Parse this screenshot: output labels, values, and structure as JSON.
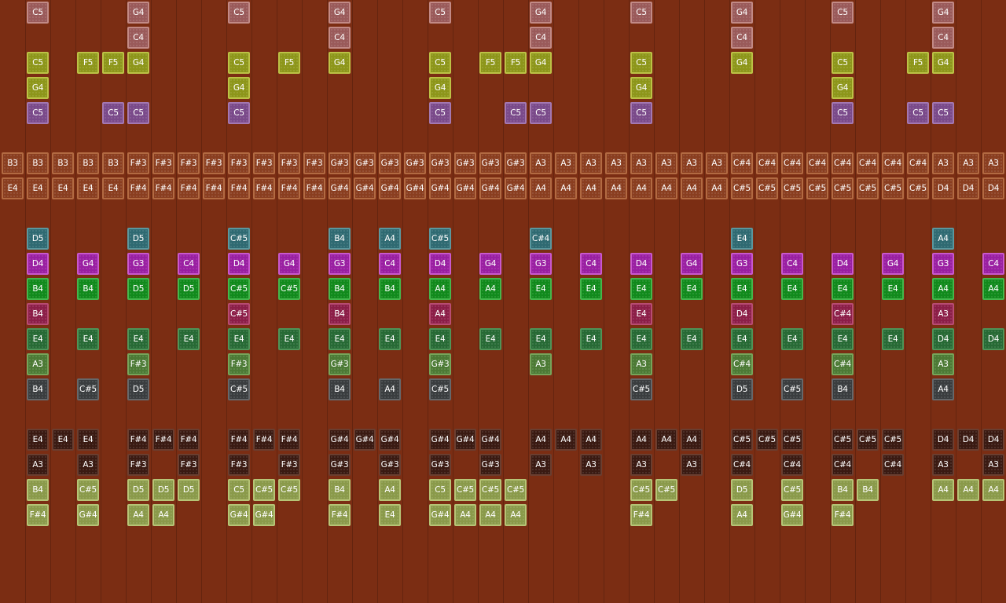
{
  "grid": {
    "columns": 40,
    "row_count": 21,
    "background": "#7b2d13"
  },
  "palette": {
    "pink": {
      "bg": "#9a5a5a",
      "border": "#c28a86",
      "text": "#ffffff"
    },
    "lime": {
      "bg": "#8d961a",
      "border": "#bcc246",
      "text": "#ffffff"
    },
    "violet": {
      "bg": "#7a4a8a",
      "border": "#a478b2",
      "text": "#ffffff"
    },
    "copper": {
      "bg": "#8a3e20",
      "border": "#b26a42",
      "text": "#ffffff"
    },
    "teal": {
      "bg": "#2f6a72",
      "border": "#5a979e",
      "text": "#ffffff"
    },
    "magenta": {
      "bg": "#9a1fa2",
      "border": "#c958ce",
      "text": "#ffffff"
    },
    "green": {
      "bg": "#118a1c",
      "border": "#45b64c",
      "text": "#ffffff"
    },
    "crimson": {
      "bg": "#8c1e48",
      "border": "#b84c72",
      "text": "#ffffff"
    },
    "forest": {
      "bg": "#276a35",
      "border": "#4f9458",
      "text": "#ffffff"
    },
    "olive": {
      "bg": "#4c7a35",
      "border": "#76a45a",
      "text": "#ffffff"
    },
    "slate": {
      "bg": "#3a3d3f",
      "border": "#65686b",
      "text": "#ffffff"
    },
    "dark": {
      "bg": "#3a1a12",
      "border": "#6a3e30",
      "text": "#ffffff"
    },
    "sage": {
      "bg": "#8a9a4a",
      "border": "#b6c476",
      "text": "#ffffff"
    }
  },
  "rows": [
    {
      "row": 0,
      "color": "pink",
      "cells": [
        [
          1,
          "C5"
        ],
        [
          5,
          "G4"
        ],
        [
          9,
          "C5"
        ],
        [
          13,
          "G4"
        ],
        [
          17,
          "C5"
        ],
        [
          21,
          "G4"
        ],
        [
          25,
          "C5"
        ],
        [
          29,
          "G4"
        ],
        [
          33,
          "C5"
        ],
        [
          37,
          "G4"
        ]
      ]
    },
    {
      "row": 1,
      "color": "pink",
      "cells": [
        [
          5,
          "C4"
        ],
        [
          13,
          "C4"
        ],
        [
          21,
          "C4"
        ],
        [
          29,
          "C4"
        ],
        [
          37,
          "C4"
        ]
      ]
    },
    {
      "row": 2,
      "color": "lime",
      "cells": [
        [
          1,
          "C5"
        ],
        [
          3,
          "F5"
        ],
        [
          4,
          "F5"
        ],
        [
          5,
          "G4"
        ],
        [
          9,
          "C5"
        ],
        [
          11,
          "F5"
        ],
        [
          13,
          "G4"
        ],
        [
          17,
          "C5"
        ],
        [
          19,
          "F5"
        ],
        [
          20,
          "F5"
        ],
        [
          21,
          "G4"
        ],
        [
          25,
          "C5"
        ],
        [
          29,
          "G4"
        ],
        [
          33,
          "C5"
        ],
        [
          36,
          "F5"
        ],
        [
          37,
          "G4"
        ]
      ]
    },
    {
      "row": 3,
      "color": "lime",
      "cells": [
        [
          1,
          "G4"
        ],
        [
          9,
          "G4"
        ],
        [
          17,
          "G4"
        ],
        [
          25,
          "G4"
        ],
        [
          33,
          "G4"
        ]
      ]
    },
    {
      "row": 4,
      "color": "violet",
      "cells": [
        [
          1,
          "C5"
        ],
        [
          4,
          "C5"
        ],
        [
          5,
          "C5"
        ],
        [
          9,
          "C5"
        ],
        [
          17,
          "C5"
        ],
        [
          20,
          "C5"
        ],
        [
          21,
          "C5"
        ],
        [
          25,
          "C5"
        ],
        [
          33,
          "C5"
        ],
        [
          36,
          "C5"
        ],
        [
          37,
          "C5"
        ]
      ]
    },
    {
      "row": 5,
      "color": "copper",
      "cells": []
    },
    {
      "row": 6,
      "color": "copper",
      "cells": [
        [
          0,
          "B3"
        ],
        [
          1,
          "B3"
        ],
        [
          2,
          "B3"
        ],
        [
          3,
          "B3"
        ],
        [
          4,
          "B3"
        ],
        [
          5,
          "F#3"
        ],
        [
          6,
          "F#3"
        ],
        [
          7,
          "F#3"
        ],
        [
          8,
          "F#3"
        ],
        [
          9,
          "F#3"
        ],
        [
          10,
          "F#3"
        ],
        [
          11,
          "F#3"
        ],
        [
          12,
          "F#3"
        ],
        [
          13,
          "G#3"
        ],
        [
          14,
          "G#3"
        ],
        [
          15,
          "G#3"
        ],
        [
          16,
          "G#3"
        ],
        [
          17,
          "G#3"
        ],
        [
          18,
          "G#3"
        ],
        [
          19,
          "G#3"
        ],
        [
          20,
          "G#3"
        ],
        [
          21,
          "A3"
        ],
        [
          22,
          "A3"
        ],
        [
          23,
          "A3"
        ],
        [
          24,
          "A3"
        ],
        [
          25,
          "A3"
        ],
        [
          26,
          "A3"
        ],
        [
          27,
          "A3"
        ],
        [
          28,
          "A3"
        ],
        [
          29,
          "C#4"
        ],
        [
          30,
          "C#4"
        ],
        [
          31,
          "C#4"
        ],
        [
          32,
          "C#4"
        ],
        [
          33,
          "C#4"
        ],
        [
          34,
          "C#4"
        ],
        [
          35,
          "C#4"
        ],
        [
          36,
          "C#4"
        ],
        [
          37,
          "A3"
        ],
        [
          38,
          "A3"
        ],
        [
          39,
          "A3"
        ]
      ]
    },
    {
      "row": 7,
      "color": "copper",
      "cells": [
        [
          0,
          "E4"
        ],
        [
          1,
          "E4"
        ],
        [
          2,
          "E4"
        ],
        [
          3,
          "E4"
        ],
        [
          4,
          "E4"
        ],
        [
          5,
          "F#4"
        ],
        [
          6,
          "F#4"
        ],
        [
          7,
          "F#4"
        ],
        [
          8,
          "F#4"
        ],
        [
          9,
          "F#4"
        ],
        [
          10,
          "F#4"
        ],
        [
          11,
          "F#4"
        ],
        [
          12,
          "F#4"
        ],
        [
          13,
          "G#4"
        ],
        [
          14,
          "G#4"
        ],
        [
          15,
          "G#4"
        ],
        [
          16,
          "G#4"
        ],
        [
          17,
          "G#4"
        ],
        [
          18,
          "G#4"
        ],
        [
          19,
          "G#4"
        ],
        [
          20,
          "G#4"
        ],
        [
          21,
          "A4"
        ],
        [
          22,
          "A4"
        ],
        [
          23,
          "A4"
        ],
        [
          24,
          "A4"
        ],
        [
          25,
          "A4"
        ],
        [
          26,
          "A4"
        ],
        [
          27,
          "A4"
        ],
        [
          28,
          "A4"
        ],
        [
          29,
          "C#5"
        ],
        [
          30,
          "C#5"
        ],
        [
          31,
          "C#5"
        ],
        [
          32,
          "C#5"
        ],
        [
          33,
          "C#5"
        ],
        [
          34,
          "C#5"
        ],
        [
          35,
          "C#5"
        ],
        [
          36,
          "C#5"
        ],
        [
          37,
          "D4"
        ],
        [
          38,
          "D4"
        ],
        [
          39,
          "D4"
        ]
      ]
    },
    {
      "row": 8,
      "color": "copper",
      "cells": []
    },
    {
      "row": 9,
      "color": "teal",
      "cells": [
        [
          1,
          "D5"
        ],
        [
          5,
          "D5"
        ],
        [
          9,
          "C#5"
        ],
        [
          13,
          "B4"
        ],
        [
          15,
          "A4"
        ],
        [
          17,
          "C#5"
        ],
        [
          21,
          "C#4"
        ],
        [
          29,
          "E4"
        ],
        [
          37,
          "A4"
        ]
      ]
    },
    {
      "row": 10,
      "color": "magenta",
      "cells": [
        [
          1,
          "D4"
        ],
        [
          3,
          "G4"
        ],
        [
          5,
          "G3"
        ],
        [
          7,
          "C4"
        ],
        [
          9,
          "D4"
        ],
        [
          11,
          "G4"
        ],
        [
          13,
          "G3"
        ],
        [
          15,
          "C4"
        ],
        [
          17,
          "D4"
        ],
        [
          19,
          "G4"
        ],
        [
          21,
          "G3"
        ],
        [
          23,
          "C4"
        ],
        [
          25,
          "D4"
        ],
        [
          27,
          "G4"
        ],
        [
          29,
          "G3"
        ],
        [
          31,
          "C4"
        ],
        [
          33,
          "D4"
        ],
        [
          35,
          "G4"
        ],
        [
          37,
          "G3"
        ],
        [
          39,
          "C4"
        ]
      ]
    },
    {
      "row": 11,
      "color": "green",
      "cells": [
        [
          1,
          "B4"
        ],
        [
          3,
          "B4"
        ],
        [
          5,
          "D5"
        ],
        [
          7,
          "D5"
        ],
        [
          9,
          "C#5"
        ],
        [
          11,
          "C#5"
        ],
        [
          13,
          "B4"
        ],
        [
          15,
          "B4"
        ],
        [
          17,
          "A4"
        ],
        [
          19,
          "A4"
        ],
        [
          21,
          "E4"
        ],
        [
          23,
          "E4"
        ],
        [
          25,
          "E4"
        ],
        [
          27,
          "E4"
        ],
        [
          29,
          "E4"
        ],
        [
          31,
          "E4"
        ],
        [
          33,
          "E4"
        ],
        [
          35,
          "E4"
        ],
        [
          37,
          "A4"
        ],
        [
          39,
          "A4"
        ]
      ]
    },
    {
      "row": 12,
      "color": "crimson",
      "cells": [
        [
          1,
          "B4"
        ],
        [
          9,
          "C#5"
        ],
        [
          13,
          "B4"
        ],
        [
          17,
          "A4"
        ],
        [
          25,
          "E4"
        ],
        [
          29,
          "D4"
        ],
        [
          33,
          "C#4"
        ],
        [
          37,
          "A3"
        ]
      ]
    },
    {
      "row": 13,
      "color": "forest",
      "cells": [
        [
          1,
          "E4"
        ],
        [
          3,
          "E4"
        ],
        [
          5,
          "E4"
        ],
        [
          7,
          "E4"
        ],
        [
          9,
          "E4"
        ],
        [
          11,
          "E4"
        ],
        [
          13,
          "E4"
        ],
        [
          15,
          "E4"
        ],
        [
          17,
          "E4"
        ],
        [
          19,
          "E4"
        ],
        [
          21,
          "E4"
        ],
        [
          23,
          "E4"
        ],
        [
          25,
          "E4"
        ],
        [
          27,
          "E4"
        ],
        [
          29,
          "E4"
        ],
        [
          31,
          "E4"
        ],
        [
          33,
          "E4"
        ],
        [
          35,
          "E4"
        ],
        [
          37,
          "D4"
        ],
        [
          39,
          "D4"
        ]
      ]
    },
    {
      "row": 14,
      "color": "olive",
      "cells": [
        [
          1,
          "A3"
        ],
        [
          5,
          "F#3"
        ],
        [
          9,
          "F#3"
        ],
        [
          13,
          "G#3"
        ],
        [
          17,
          "G#3"
        ],
        [
          21,
          "A3"
        ],
        [
          25,
          "A3"
        ],
        [
          29,
          "C#4"
        ],
        [
          33,
          "C#4"
        ],
        [
          37,
          "A3"
        ]
      ]
    },
    {
      "row": 15,
      "color": "slate",
      "cells": [
        [
          1,
          "B4"
        ],
        [
          3,
          "C#5"
        ],
        [
          5,
          "D5"
        ],
        [
          9,
          "C#5"
        ],
        [
          13,
          "B4"
        ],
        [
          15,
          "A4"
        ],
        [
          17,
          "C#5"
        ],
        [
          25,
          "C#5"
        ],
        [
          29,
          "D5"
        ],
        [
          31,
          "C#5"
        ],
        [
          33,
          "B4"
        ],
        [
          37,
          "A4"
        ]
      ]
    },
    {
      "row": 16,
      "color": "dark",
      "cells": []
    },
    {
      "row": 17,
      "color": "dark",
      "cells": [
        [
          1,
          "E4"
        ],
        [
          2,
          "E4"
        ],
        [
          3,
          "E4"
        ],
        [
          5,
          "F#4"
        ],
        [
          6,
          "F#4"
        ],
        [
          7,
          "F#4"
        ],
        [
          9,
          "F#4"
        ],
        [
          10,
          "F#4"
        ],
        [
          11,
          "F#4"
        ],
        [
          13,
          "G#4"
        ],
        [
          14,
          "G#4"
        ],
        [
          15,
          "G#4"
        ],
        [
          17,
          "G#4"
        ],
        [
          18,
          "G#4"
        ],
        [
          19,
          "G#4"
        ],
        [
          21,
          "A4"
        ],
        [
          22,
          "A4"
        ],
        [
          23,
          "A4"
        ],
        [
          25,
          "A4"
        ],
        [
          26,
          "A4"
        ],
        [
          27,
          "A4"
        ],
        [
          29,
          "C#5"
        ],
        [
          30,
          "C#5"
        ],
        [
          31,
          "C#5"
        ],
        [
          33,
          "C#5"
        ],
        [
          34,
          "C#5"
        ],
        [
          35,
          "C#5"
        ],
        [
          37,
          "D4"
        ],
        [
          38,
          "D4"
        ],
        [
          39,
          "D4"
        ]
      ]
    },
    {
      "row": 18,
      "color": "dark",
      "cells": [
        [
          1,
          "A3"
        ],
        [
          3,
          "A3"
        ],
        [
          5,
          "F#3"
        ],
        [
          7,
          "F#3"
        ],
        [
          9,
          "F#3"
        ],
        [
          11,
          "F#3"
        ],
        [
          13,
          "G#3"
        ],
        [
          15,
          "G#3"
        ],
        [
          17,
          "G#3"
        ],
        [
          19,
          "G#3"
        ],
        [
          21,
          "A3"
        ],
        [
          23,
          "A3"
        ],
        [
          25,
          "A3"
        ],
        [
          27,
          "A3"
        ],
        [
          29,
          "C#4"
        ],
        [
          31,
          "C#4"
        ],
        [
          33,
          "C#4"
        ],
        [
          35,
          "C#4"
        ],
        [
          37,
          "A3"
        ],
        [
          39,
          "A3"
        ]
      ]
    },
    {
      "row": 19,
      "color": "sage",
      "cells": [
        [
          1,
          "B4"
        ],
        [
          3,
          "C#5"
        ],
        [
          5,
          "D5"
        ],
        [
          6,
          "D5"
        ],
        [
          7,
          "D5"
        ],
        [
          9,
          "C5"
        ],
        [
          10,
          "C#5"
        ],
        [
          11,
          "C#5"
        ],
        [
          13,
          "B4"
        ],
        [
          15,
          "A4"
        ],
        [
          17,
          "C5"
        ],
        [
          18,
          "C#5"
        ],
        [
          19,
          "C#5"
        ],
        [
          20,
          "C#5"
        ],
        [
          25,
          "C#5"
        ],
        [
          26,
          "C#5"
        ],
        [
          29,
          "D5"
        ],
        [
          31,
          "C#5"
        ],
        [
          33,
          "B4"
        ],
        [
          34,
          "B4"
        ],
        [
          37,
          "A4"
        ],
        [
          38,
          "A4"
        ],
        [
          39,
          "A4"
        ]
      ]
    },
    {
      "row": 20,
      "color": "sage",
      "cells": [
        [
          1,
          "F#4"
        ],
        [
          3,
          "G#4"
        ],
        [
          5,
          "A4"
        ],
        [
          6,
          "A4"
        ],
        [
          9,
          "G#4"
        ],
        [
          10,
          "G#4"
        ],
        [
          13,
          "F#4"
        ],
        [
          15,
          "E4"
        ],
        [
          17,
          "G#4"
        ],
        [
          18,
          "A4"
        ],
        [
          19,
          "A4"
        ],
        [
          20,
          "A4"
        ],
        [
          25,
          "F#4"
        ],
        [
          29,
          "A4"
        ],
        [
          31,
          "G#4"
        ],
        [
          33,
          "F#4"
        ]
      ]
    }
  ]
}
